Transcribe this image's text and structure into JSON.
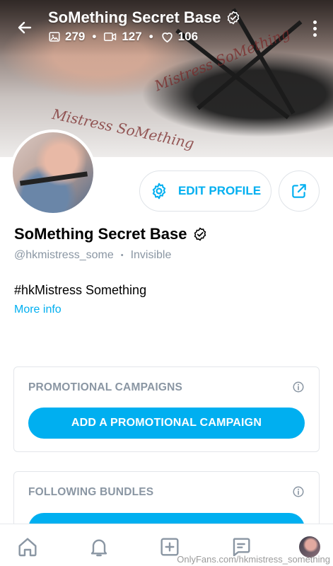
{
  "header": {
    "title": "SoMething Secret Base",
    "stats": {
      "photos": "279",
      "videos": "127",
      "likes": "106"
    },
    "separator": "•"
  },
  "cover": {
    "watermark_top": "Mistress SoMething",
    "watermark_bottom": "Mistress SoMething"
  },
  "actions": {
    "edit_profile_label": "EDIT PROFILE"
  },
  "profile": {
    "name": "SoMething Secret Base",
    "handle": "@hkmistress_some",
    "handle_separator": "•",
    "status": "Invisible",
    "bio": "#hkMistress Something",
    "more_info": "More info"
  },
  "cards": {
    "promotional": {
      "title": "PROMOTIONAL CAMPAIGNS",
      "button_label": "ADD A PROMOTIONAL CAMPAIGN"
    },
    "bundles": {
      "title": "FOLLOWING BUNDLES"
    }
  },
  "bottom_nav": {
    "items": [
      "home-icon",
      "notifications-icon",
      "add-post-icon",
      "messages-icon",
      "profile-avatar"
    ]
  },
  "watermark": "OnlyFans.com/hkmistress_something",
  "colors": {
    "accent": "#00aff0",
    "muted": "#8a96a3",
    "border": "#e3e6ea"
  }
}
